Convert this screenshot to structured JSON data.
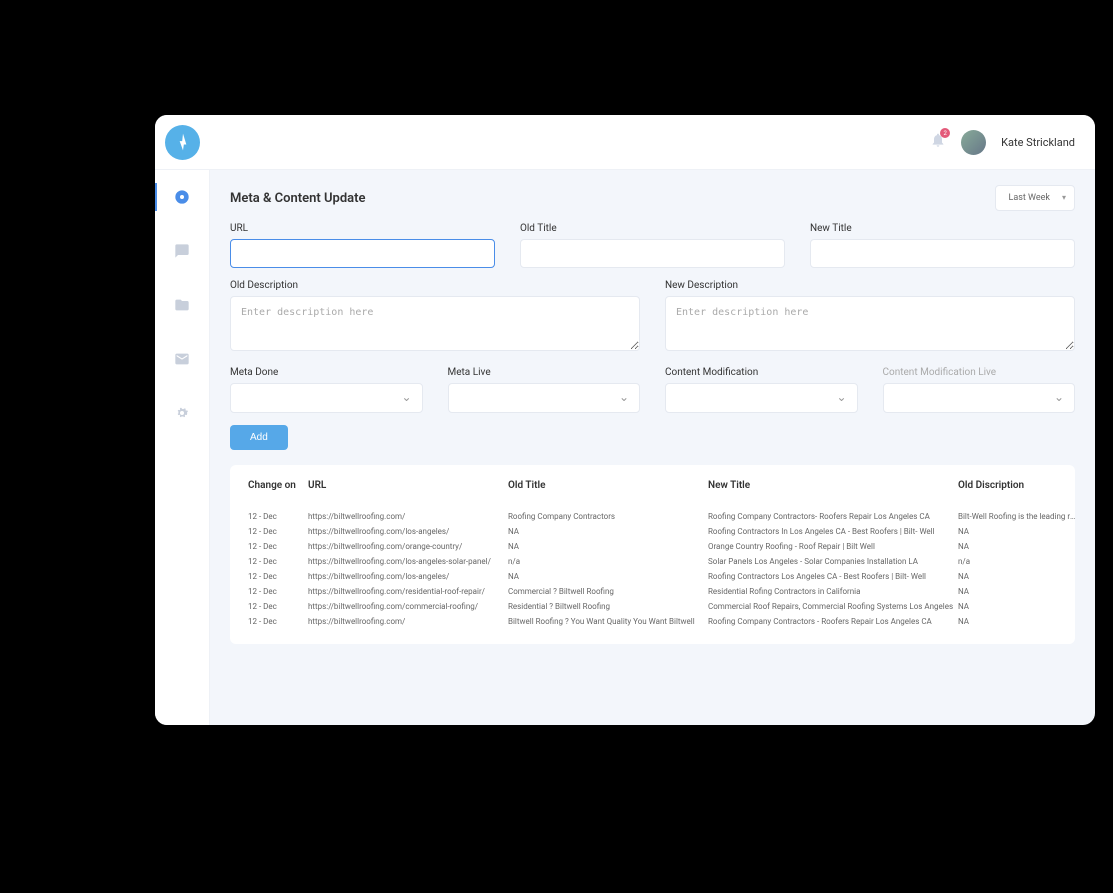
{
  "header": {
    "username": "Kate Strickland",
    "notif_count": "2"
  },
  "page": {
    "title": "Meta & Content Update",
    "filter": "Last Week"
  },
  "form": {
    "url_label": "URL",
    "old_title_label": "Old Title",
    "new_title_label": "New Title",
    "old_desc_label": "Old Description",
    "old_desc_placeholder": "Enter description here",
    "new_desc_label": "New Description",
    "new_desc_placeholder": "Enter description here",
    "meta_done_label": "Meta Done",
    "meta_live_label": "Meta Live",
    "content_mod_label": "Content Modification",
    "content_mod_live_label": "Content Modification Live",
    "add_button": "Add"
  },
  "table": {
    "headers": {
      "change_on": "Change on",
      "url": "URL",
      "old_title": "Old Title",
      "new_title": "New Title",
      "old_desc": "Old Discription"
    },
    "rows": [
      {
        "date": "12 - Dec",
        "url": "https://biltwellroofing.com/",
        "old": "Roofing Company Contractors",
        "new": "Roofing Company Contractors- Roofers Repair Los Angeles CA",
        "desc": "Bilt-Well Roofing is the leading roofing"
      },
      {
        "date": "12 - Dec",
        "url": "https://biltwellroofing.com/los-angeles/",
        "old": "NA",
        "new": "Roofing Contractors In Los Angeles CA - Best Roofers | Bilt- Well",
        "desc": "NA"
      },
      {
        "date": "12 - Dec",
        "url": "https://biltwellroofing.com/orange-country/",
        "old": "NA",
        "new": "Orange Country Roofing - Roof Repair | Bilt Well",
        "desc": "NA"
      },
      {
        "date": "12 - Dec",
        "url": "https://biltwellroofing.com/los-angeles-solar-panel/",
        "old": "n/a",
        "new": "Solar Panels Los Angeles - Solar Companies Installation LA",
        "desc": "n/a"
      },
      {
        "date": "12 - Dec",
        "url": "https://biltwellroofing.com/los-angeles/",
        "old": "NA",
        "new": "Roofing Contractors Los Angeles CA - Best Roofers | Bilt- Well",
        "desc": "NA"
      },
      {
        "date": "12 - Dec",
        "url": "https://biltwellroofing.com/residential-roof-repair/",
        "old": "Commercial ? Biltwell Roofing",
        "new": "Residential Rofing Contractors in California",
        "desc": "NA"
      },
      {
        "date": "12 - Dec",
        "url": "https://biltwellroofing.com/commercial-roofing/",
        "old": "Residential ? Biltwell Roofing",
        "new": "Commercial Roof Repairs, Commercial Roofing Systems Los Angeles",
        "desc": "NA"
      },
      {
        "date": "12 - Dec",
        "url": "https://biltwellroofing.com/",
        "old": "Biltwell Roofing ? You Want Quality You Want Biltwell",
        "new": "Roofing Company Contractors - Roofers Repair Los Angeles CA",
        "desc": "NA"
      }
    ]
  }
}
